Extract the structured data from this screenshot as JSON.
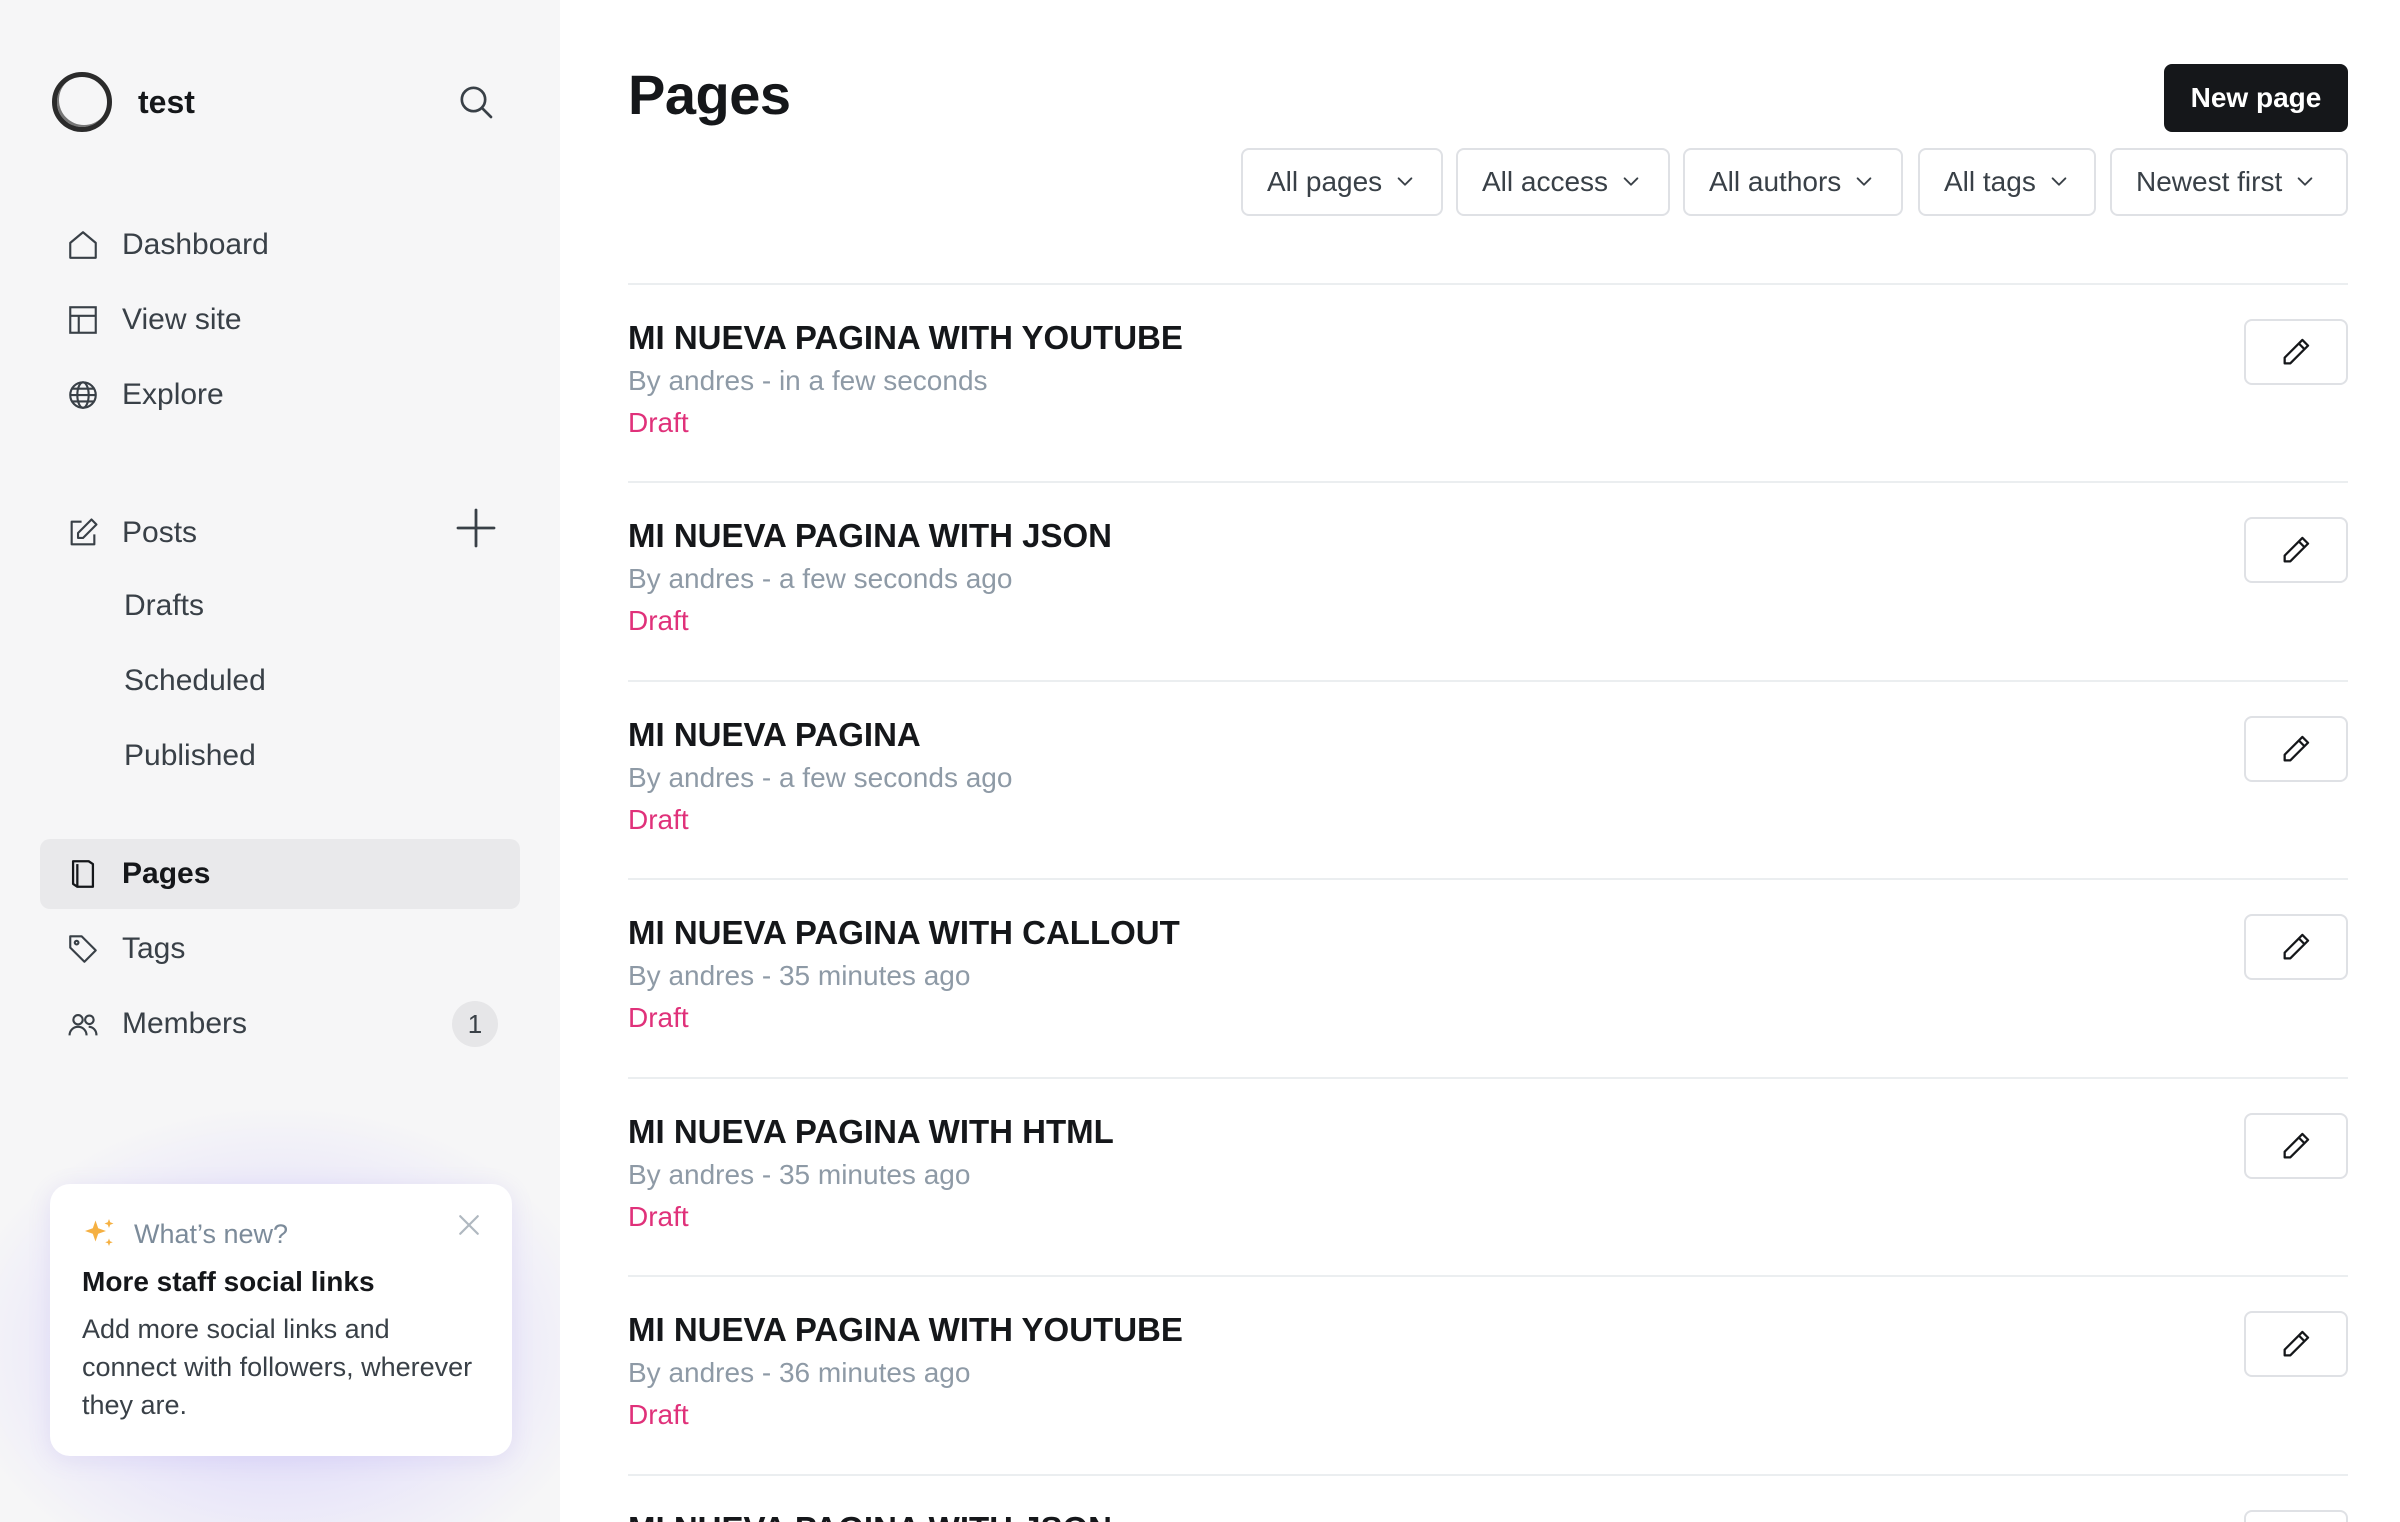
{
  "brand": {
    "name": "test"
  },
  "sidebar": {
    "nav": [
      {
        "label": "Dashboard",
        "icon": "home-icon"
      },
      {
        "label": "View site",
        "icon": "layout-icon"
      },
      {
        "label": "Explore",
        "icon": "globe-icon"
      }
    ],
    "posts": {
      "label": "Posts",
      "icon": "edit-icon"
    },
    "post_subitems": [
      "Drafts",
      "Scheduled",
      "Published"
    ],
    "pages": {
      "label": "Pages",
      "icon": "page-icon"
    },
    "tags": {
      "label": "Tags",
      "icon": "tag-icon"
    },
    "members": {
      "label": "Members",
      "icon": "members-icon",
      "count": "1"
    },
    "whats_new": {
      "label": "What’s new?",
      "title": "More staff social links",
      "body": "Add more social links and connect with followers, wherever they are."
    }
  },
  "main": {
    "title": "Pages",
    "new_page_label": "New page",
    "filters": [
      "All pages",
      "All access",
      "All authors",
      "All tags",
      "Newest first"
    ],
    "rows": [
      {
        "title": "MI NUEVA PAGINA WITH YOUTUBE",
        "meta": "By andres - in a few seconds",
        "status": "Draft"
      },
      {
        "title": "MI NUEVA PAGINA WITH JSON",
        "meta": "By andres - a few seconds ago",
        "status": "Draft"
      },
      {
        "title": "MI NUEVA PAGINA",
        "meta": "By andres - a few seconds ago",
        "status": "Draft"
      },
      {
        "title": "MI NUEVA PAGINA WITH CALLOUT",
        "meta": "By andres - 35 minutes ago",
        "status": "Draft"
      },
      {
        "title": "MI NUEVA PAGINA WITH HTML",
        "meta": "By andres - 35 minutes ago",
        "status": "Draft"
      },
      {
        "title": "MI NUEVA PAGINA WITH YOUTUBE",
        "meta": "By andres - 36 minutes ago",
        "status": "Draft"
      },
      {
        "title": "MI NUEVA PAGINA WITH JSON",
        "meta": "",
        "status": ""
      }
    ]
  },
  "colors": {
    "accent": "#15171a",
    "draft": "#e0317a",
    "sidebar_bg": "#f6f6f7",
    "muted": "#8e9aa6"
  }
}
